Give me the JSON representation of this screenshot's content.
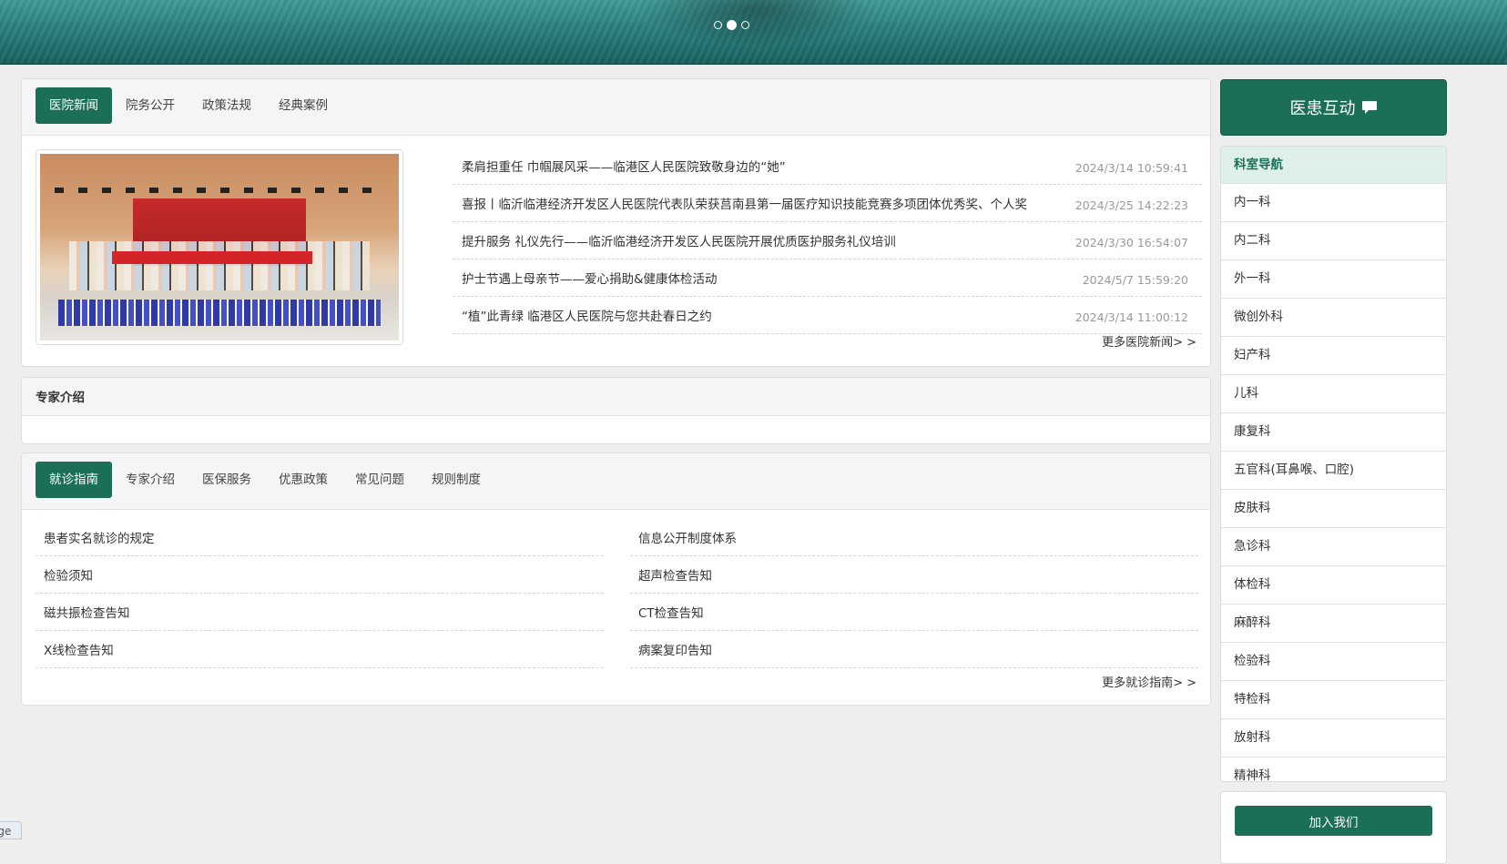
{
  "carousel": {
    "slides": 3,
    "active_index": 1
  },
  "news_panel": {
    "tabs": [
      "医院新闻",
      "院务公开",
      "政策法规",
      "经典案例"
    ],
    "active_tab": 0,
    "items": [
      {
        "title": "柔肩担重任 巾帼展风采——临港区人民医院致敬身边的“她”",
        "date": "2024/3/14 10:59:41"
      },
      {
        "title": "喜报丨临沂临港经济开发区人民医院代表队荣获莒南县第一届医疗知识技能竞赛多项团体优秀奖、个人奖",
        "date": "2024/3/25 14:22:23"
      },
      {
        "title": "提升服务 礼仪先行——临沂临港经济开发区人民医院开展优质医护服务礼仪培训",
        "date": "2024/3/30 16:54:07"
      },
      {
        "title": "护士节遇上母亲节——爱心捐助&健康体检活动",
        "date": "2024/5/7 15:59:20"
      },
      {
        "title": "“植”此青绿 临港区人民医院与您共赴春日之约",
        "date": "2024/3/14 11:00:12"
      }
    ],
    "more": "更多医院新闻> >"
  },
  "expert_panel": {
    "title": "专家介绍"
  },
  "guide_panel": {
    "tabs": [
      "就诊指南",
      "专家介绍",
      "医保服务",
      "优惠政策",
      "常见问题",
      "规则制度"
    ],
    "active_tab": 0,
    "left_items": [
      "患者实名就诊的规定",
      "检验须知",
      "磁共振检查告知",
      "X线检查告知"
    ],
    "right_items": [
      "信息公开制度体系",
      "超声检查告知",
      "CT检查告知",
      "病案复印告知"
    ],
    "more": "更多就诊指南> >"
  },
  "sidebar": {
    "interaction_button": "医患互动",
    "dept_nav_title": "科室导航",
    "departments": [
      "内一科",
      "内二科",
      "外一科",
      "微创外科",
      "妇产科",
      "儿科",
      "康复科",
      "五官科(耳鼻喉、口腔)",
      "皮肤科",
      "急诊科",
      "体检科",
      "麻醉科",
      "检验科",
      "特检科",
      "放射科",
      "精神科"
    ],
    "join_button": "加入我们"
  },
  "corner_tab_text": "age",
  "colors": {
    "accent": "#1b6f56",
    "nav_head_bg": "#dff0ea",
    "banner": "#2a7f7d"
  }
}
